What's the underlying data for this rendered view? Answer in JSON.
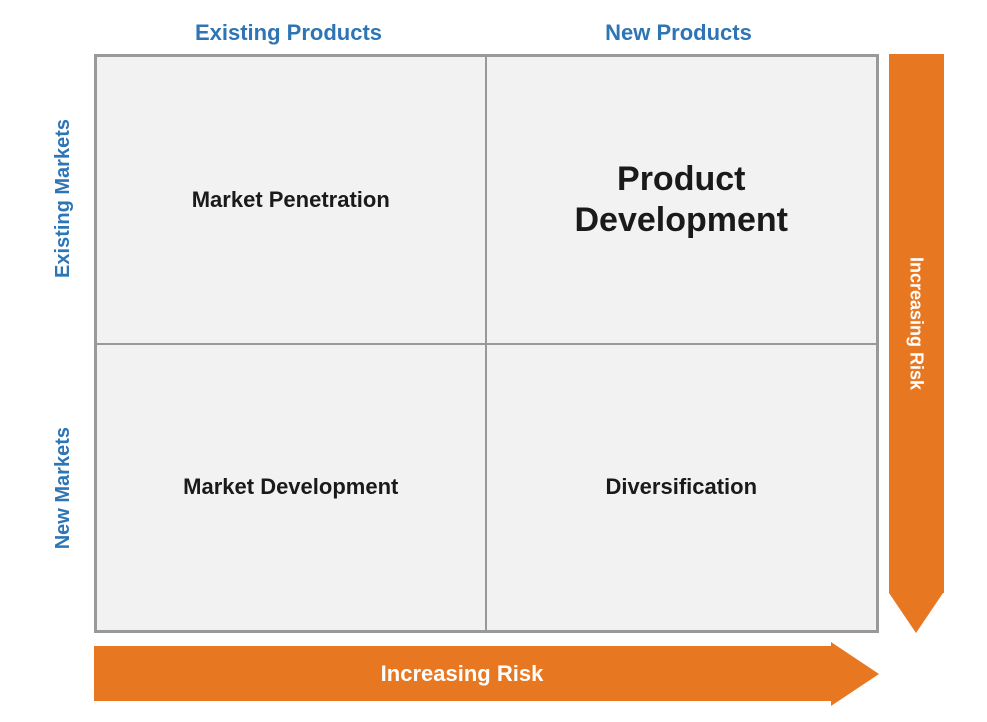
{
  "header": {
    "col1_label": "Existing Products",
    "col2_label": "New Products"
  },
  "rows": {
    "row1_label": "Existing Markets",
    "row2_label": "New Markets"
  },
  "cells": {
    "top_left": "Market Penetration",
    "top_right_line1": "Product",
    "top_right_line2": "Development",
    "bottom_left": "Market Development",
    "bottom_right": "Diversification"
  },
  "risk": {
    "right_label": "Increasing Risk",
    "bottom_label": "Increasing Risk"
  }
}
